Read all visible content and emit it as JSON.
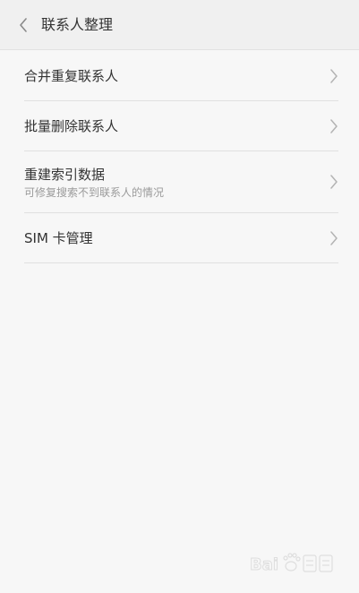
{
  "header": {
    "title": "联系人整理",
    "back_icon": "chevron-left-icon"
  },
  "items": [
    {
      "label": "合并重复联系人",
      "icon": "chevron-right-icon"
    },
    {
      "label": "批量删除联系人",
      "icon": "chevron-right-icon"
    },
    {
      "label": "重建索引数据",
      "sublabel": "可修复搜索不到联系人的情况",
      "icon": "chevron-right-icon"
    },
    {
      "label": "SIM 卡管理",
      "icon": "chevron-right-icon"
    }
  ],
  "colors": {
    "background": "#f7f7f7",
    "header_background": "#f0f0f0",
    "text": "#333333",
    "subtext": "#9a9a9a",
    "divider": "#e0e0e0",
    "chevron": "#b3b3b3"
  }
}
